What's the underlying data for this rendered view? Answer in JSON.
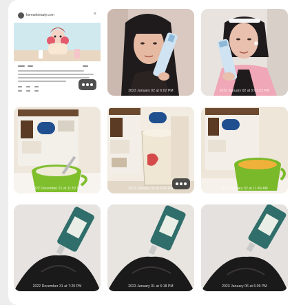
{
  "tiles": [
    {
      "id": "post",
      "caption": "",
      "has_more": true,
      "accent": "#f4c6c9"
    },
    {
      "id": "face-1",
      "caption": "2023 January 02 at 6:02 PM",
      "has_more": false,
      "accent": "#b7d7ea"
    },
    {
      "id": "face-2",
      "caption": "2023 January 02 at 9:01:22 PM",
      "has_more": false,
      "accent": "#b7d7ea"
    },
    {
      "id": "drink-1",
      "caption": "2022 December 21 at 11:52 PM",
      "has_more": false,
      "accent": "#7fbf2d"
    },
    {
      "id": "drink-2",
      "caption": "2023 January 02 at 6:02 PM",
      "has_more": true,
      "accent": "#e8dcc6"
    },
    {
      "id": "drink-3",
      "caption": "2023 January 02 at 11:49 AM",
      "has_more": false,
      "accent": "#f0b13a"
    },
    {
      "id": "scalp-1",
      "caption": "2022 December 31 at 7:20 PM",
      "has_more": false,
      "accent": "#2f6e6a"
    },
    {
      "id": "scalp-2",
      "caption": "2023 January 01 at 6:18 PM",
      "has_more": false,
      "accent": "#2f6e6a"
    },
    {
      "id": "scalp-3",
      "caption": "2023 January 06 at 6:09 PM",
      "has_more": false,
      "accent": "#2f6e6a"
    }
  ],
  "post": {
    "account": "koreanbeauty.com"
  },
  "more_icon": "more-horizontal-icon"
}
